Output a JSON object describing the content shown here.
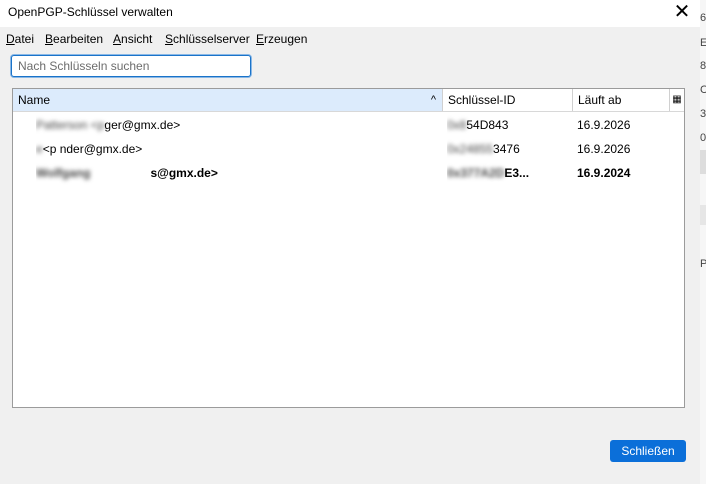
{
  "window": {
    "title": "OpenPGP-Schlüssel verwalten",
    "close_glyph": "✕"
  },
  "menu": [
    {
      "accel": "D",
      "rest": "atei"
    },
    {
      "accel": "B",
      "rest": "earbeiten"
    },
    {
      "accel": "A",
      "rest": "nsicht"
    },
    {
      "accel": "S",
      "rest": "chlüsselserver"
    },
    {
      "accel": "E",
      "rest": "rzeugen"
    }
  ],
  "search": {
    "placeholder": "Nach Schlüsseln suchen",
    "value": ""
  },
  "table": {
    "columns": {
      "name": "Name",
      "key_id": "Schlüssel-ID",
      "expires": "Läuft ab"
    },
    "sort_indicator": "^",
    "column_picker_icon": "▦",
    "rows": [
      {
        "name_hidden": "Patterson <p",
        "name_visible": "ger@gmx.de>",
        "key_hidden": "0x8",
        "key_visible": "54D843",
        "expires": "16.9.2026",
        "expired": false
      },
      {
        "name_hidden": "e",
        "name_visible": "<p  nder@gmx.de>",
        "key_hidden": "0x24855",
        "key_visible": "3476",
        "expires": "16.9.2026",
        "expired": false
      },
      {
        "name_hidden": "Wolfgang",
        "name_visible": "s@gmx.de>",
        "key_hidden": "0x377A2D",
        "key_visible": "E3...",
        "expires": "16.9.2024",
        "expired": true
      }
    ]
  },
  "footer": {
    "close_label": "Schließen"
  },
  "background_peek": [
    "6",
    "E",
    "8",
    "C",
    "3",
    "0",
    "P"
  ]
}
